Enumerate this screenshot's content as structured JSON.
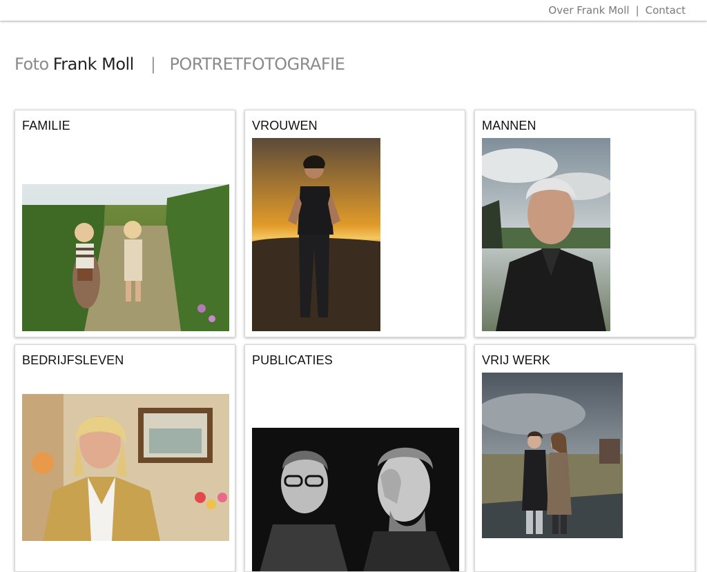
{
  "topnav": {
    "about": "Over Frank Moll",
    "separator": "|",
    "contact": "Contact"
  },
  "header": {
    "brand_prefix": "Foto",
    "brand_name": "Frank Moll",
    "separator": "|",
    "subtitle": "PORTRETFOTOGRAFIE"
  },
  "categories": [
    {
      "title": "FAMILIE"
    },
    {
      "title": "VROUWEN"
    },
    {
      "title": "MANNEN"
    },
    {
      "title": "BEDRIJFSLEVEN"
    },
    {
      "title": "PUBLICATIES"
    },
    {
      "title": "VRIJ WERK"
    }
  ]
}
